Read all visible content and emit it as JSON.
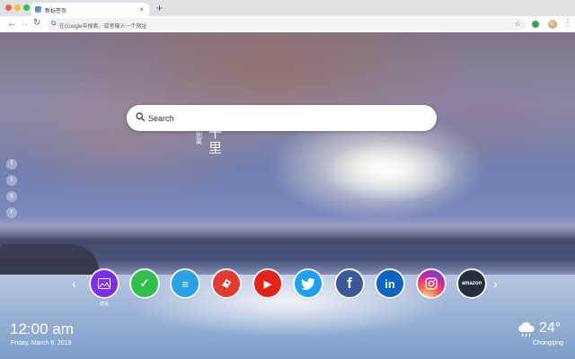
{
  "browser": {
    "tab_title": "新标签页",
    "tab_close": "×",
    "new_tab": "+",
    "back": "←",
    "forward": "→",
    "reload": "↻",
    "address_placeholder": "在Google中搜索，或者输入一个网址",
    "google_glyph": "G",
    "bookmark_star": "☆",
    "menu": "⋮"
  },
  "search": {
    "placeholder": "Search"
  },
  "calligraphy": {
    "small": "别离",
    "big": "千里"
  },
  "social": [
    {
      "icon": "facebook-icon",
      "glyph": "f"
    },
    {
      "icon": "twitter-icon",
      "glyph": "t"
    },
    {
      "icon": "share-icon",
      "glyph": "s"
    },
    {
      "icon": "reddit-icon",
      "glyph": "r"
    }
  ],
  "shortcuts": {
    "prev": "‹",
    "next": "›",
    "items": [
      {
        "name": "wallpaper",
        "label": "壁纸",
        "color": "#7b2ff0",
        "glyph": ""
      },
      {
        "name": "todo",
        "label": "",
        "color": "#2fbf4a",
        "glyph": "✓"
      },
      {
        "name": "notes",
        "label": "",
        "color": "#2aa3e6",
        "glyph": "≡"
      },
      {
        "name": "games",
        "label": "",
        "color": "#e23b2f",
        "glyph": ""
      },
      {
        "name": "youtube",
        "label": "",
        "color": "#e62117",
        "glyph": "▶"
      },
      {
        "name": "twitter",
        "label": "",
        "color": "#1da1f2",
        "glyph": ""
      },
      {
        "name": "facebook",
        "label": "",
        "color": "#3b5998",
        "glyph": "f"
      },
      {
        "name": "linkedin",
        "label": "",
        "color": "#0a66c2",
        "glyph": "in"
      },
      {
        "name": "instagram",
        "label": "",
        "color": "#c13584",
        "glyph": ""
      },
      {
        "name": "amazon",
        "label": "",
        "color": "#232f3e",
        "glyph": "amazon"
      }
    ]
  },
  "clock": {
    "time": "12:00 am",
    "date": "Friday, March 8, 2019"
  },
  "weather": {
    "temperature": "24°",
    "city": "Chongqing",
    "icon": "cloud-rain-icon"
  }
}
